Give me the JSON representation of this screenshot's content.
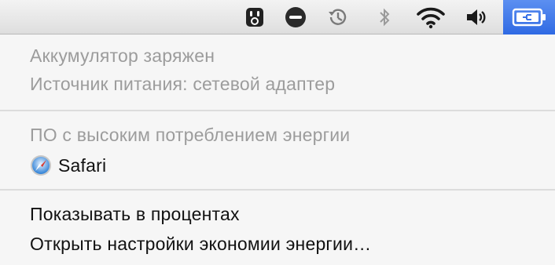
{
  "menubar": {
    "icons": [
      {
        "name": "ghostery-icon"
      },
      {
        "name": "skype-icon"
      },
      {
        "name": "time-machine-icon"
      },
      {
        "name": "bluetooth-icon"
      },
      {
        "name": "wifi-icon"
      },
      {
        "name": "volume-icon"
      },
      {
        "name": "battery-charging-icon",
        "active": true
      }
    ],
    "accent_color": "#3a72e6"
  },
  "battery_menu": {
    "status_line": "Аккумулятор заряжен",
    "power_source": "Источник питания: сетевой адаптер",
    "energy_header": "ПО с высоким потреблением энергии",
    "energy_apps": [
      {
        "label": "Safari",
        "icon": "safari-icon"
      }
    ],
    "show_percent": "Показывать в процентах",
    "open_prefs": "Открыть настройки экономии энергии…"
  }
}
